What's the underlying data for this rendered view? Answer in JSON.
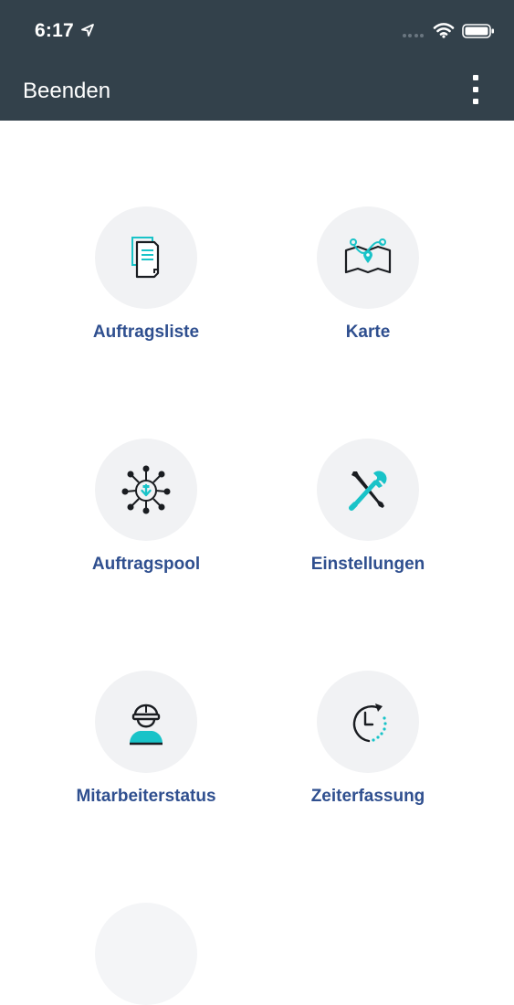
{
  "status_bar": {
    "time": "6:17",
    "icons": [
      "location-arrow-icon",
      "signal-dots-icon",
      "wifi-icon",
      "battery-icon"
    ]
  },
  "navbar": {
    "back_label": "Beenden",
    "more_icon": "more-vertical-icon"
  },
  "menu": {
    "items": [
      {
        "label": "Auftragsliste",
        "icon": "document-list-icon"
      },
      {
        "label": "Karte",
        "icon": "map-icon"
      },
      {
        "label": "Auftragspool",
        "icon": "network-pool-icon"
      },
      {
        "label": "Einstellungen",
        "icon": "tools-icon"
      },
      {
        "label": "Mitarbeiterstatus",
        "icon": "worker-helmet-icon"
      },
      {
        "label": "Zeiterfassung",
        "icon": "clock-icon"
      }
    ]
  },
  "colors": {
    "header_bg": "#33414b",
    "label_color": "#2f4f8f",
    "accent_teal": "#19c3c8",
    "circle_bg": "#f1f2f4"
  }
}
